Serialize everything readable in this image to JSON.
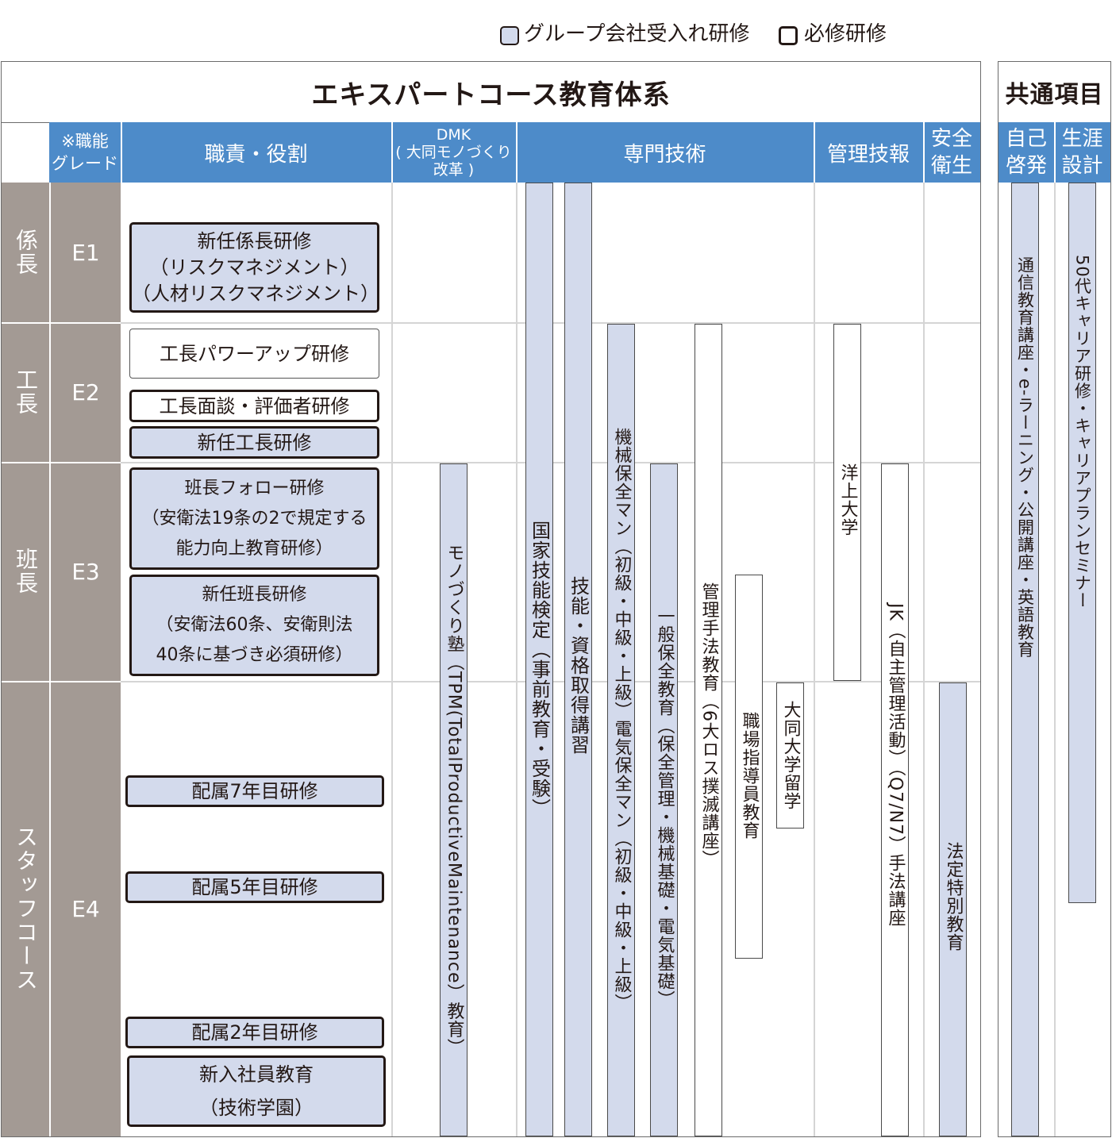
{
  "legend": {
    "group_label": "グループ会社受入れ研修",
    "required_label": "必修研修"
  },
  "title": "エキスパートコース教育体系",
  "common_title": "共通項目",
  "header": {
    "grade": "※職能\nグレード",
    "role": "職責・役割",
    "dmk": "DMK\n( 大同モノづくり\n改革 )",
    "tech": "専門技術",
    "mgmt": "管理技報",
    "safety": "安全\n衛生",
    "self": "自己\n啓発",
    "career": "生涯\n設計"
  },
  "rows": [
    {
      "role": "係長",
      "grade": "E1"
    },
    {
      "role": "工長",
      "grade": "E2"
    },
    {
      "role": "班長",
      "grade": "E3"
    },
    {
      "role": "スタッフコース",
      "grade": "E4"
    }
  ],
  "boxes": [
    {
      "text": "新任係長研修\n（リスクマネジメント）\n（人材リスクマネジメント）"
    },
    {
      "text": "工長パワーアップ研修"
    },
    {
      "text": "工長面談・評価者研修"
    },
    {
      "text": "新任工長研修"
    },
    {
      "text": "班長フォロー研修\n（安衛法19条の2で規定する\n能力向上教育研修）"
    },
    {
      "text": "新任班長研修\n（安衛法60条、安衛則法\n40条に基づき必須研修）"
    },
    {
      "text": "配属7年目研修"
    },
    {
      "text": "配属5年目研修"
    },
    {
      "text": "配属2年目研修"
    },
    {
      "text": "新入社員教育\n（技術学園）"
    }
  ],
  "bars": [
    {
      "text": "モノづくり塾（TPM(TotalProductiveMaintenance）教育）"
    },
    {
      "text": "国家技能検定（事前教育・受験）"
    },
    {
      "text": "技能・資格取得講習"
    },
    {
      "text": "機械保全マン（初級・中級・上級）電気保全マン（初級・中級・上級）"
    },
    {
      "text": "一般保全教育（保全管理・機械基礎・電気基礎）"
    },
    {
      "text": "管理手法教育（6大ロス撲滅講座）"
    },
    {
      "text": "職場指導員教育"
    },
    {
      "text": "大同大学留学"
    },
    {
      "text": "洋上大学"
    },
    {
      "text": "JK（自主管理活動）（Q7/N7）手法講座"
    },
    {
      "text": "法定特別教育"
    },
    {
      "text": "通信教育講座・e-ラーニング・公開講座・英語教育"
    },
    {
      "text": "50代キャリア研修・キャリアプランセミナー"
    }
  ]
}
